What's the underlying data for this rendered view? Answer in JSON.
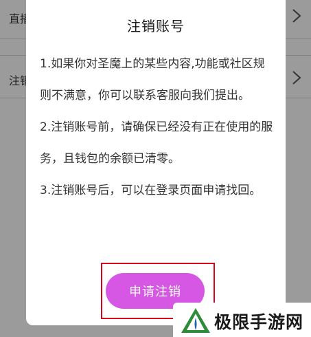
{
  "background": {
    "rows": [
      {
        "label": "直播"
      },
      {
        "label": "注销"
      }
    ]
  },
  "dialog": {
    "title": "注销账号",
    "paragraphs": [
      "1.如果你对圣魔上的某些内容,功能或社区规则不满意，你可以联系客服向我们提出。",
      "2.注销账号前，请确保已经没有正在使用的服务，且钱包的余额已清零。",
      "3.注销账号后，可以在登录页面申请找回。"
    ],
    "apply_button_label": "申请注销"
  },
  "watermark": {
    "text": "极限手游网"
  },
  "colors": {
    "overlay": "#9b9b9b",
    "button": "#d657e3",
    "highlight_frame": "#d9001b",
    "logo_green": "#2e8b3a",
    "logo_blue": "#1f5fa8"
  }
}
